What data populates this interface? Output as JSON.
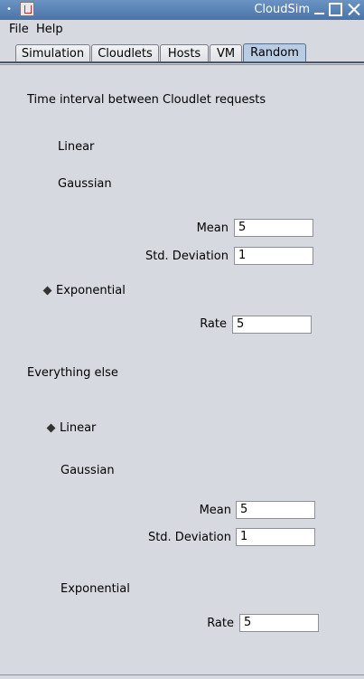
{
  "window": {
    "title": "CloudSim"
  },
  "menu": {
    "file": "File",
    "help": "Help"
  },
  "tabs": [
    "Simulation",
    "Cloudlets",
    "Hosts",
    "VM",
    "Random"
  ],
  "active_tab": "Random",
  "section1": {
    "heading": "Time interval between Cloudlet requests",
    "linear_label": "Linear",
    "gaussian_label": "Gaussian",
    "mean_label": "Mean",
    "mean_value": "5",
    "std_label": "Std. Deviation",
    "std_value": "1",
    "exponential_label": "Exponential",
    "rate_label": "Rate",
    "rate_value": "5",
    "selected": "Exponential"
  },
  "section2": {
    "heading": "Everything else",
    "linear_label": "Linear",
    "gaussian_label": "Gaussian",
    "mean_label": "Mean",
    "mean_value": "5",
    "std_label": "Std. Deviation",
    "std_value": "1",
    "exponential_label": "Exponential",
    "rate_label": "Rate",
    "rate_value": "5",
    "selected": "Linear"
  },
  "icons": [
    "system-menu-icon",
    "java-app-icon",
    "minimize-icon",
    "maximize-icon",
    "close-icon",
    "radio-selected-icon"
  ]
}
